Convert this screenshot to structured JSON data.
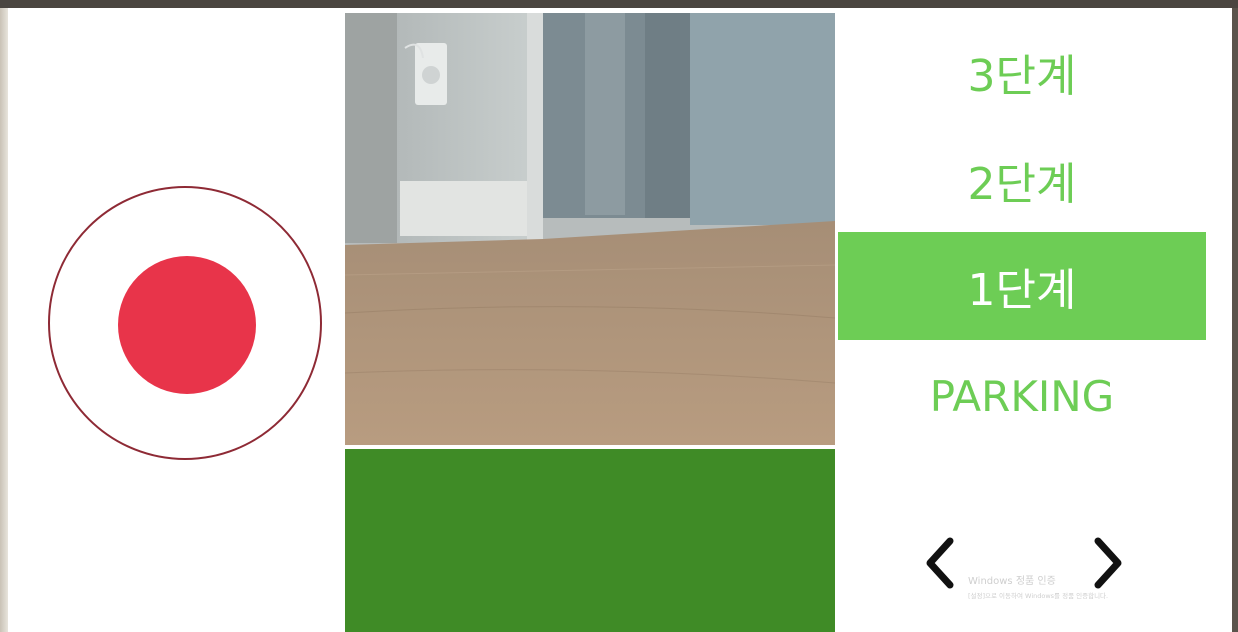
{
  "colors": {
    "record_ring": "#8e2a35",
    "record_dot": "#e8344a",
    "accent_green": "#6dcd55",
    "dark_green": "#3f8b26",
    "selected_text": "#ffffff"
  },
  "record": {
    "icon": "record-dot-icon"
  },
  "camera": {
    "icon": "camera-feed"
  },
  "gears": {
    "items": [
      {
        "label": "3단계",
        "selected": false
      },
      {
        "label": "2단계",
        "selected": false
      },
      {
        "label": "1단계",
        "selected": true
      },
      {
        "label": "PARKING",
        "selected": false
      }
    ]
  },
  "nav": {
    "prev_icon": "chevron-left-icon",
    "next_icon": "chevron-right-icon"
  },
  "watermark": {
    "title": "Windows 정품 인증",
    "subtitle": "[설정]으로 이동하여 Windows를 정품 인증합니다."
  }
}
